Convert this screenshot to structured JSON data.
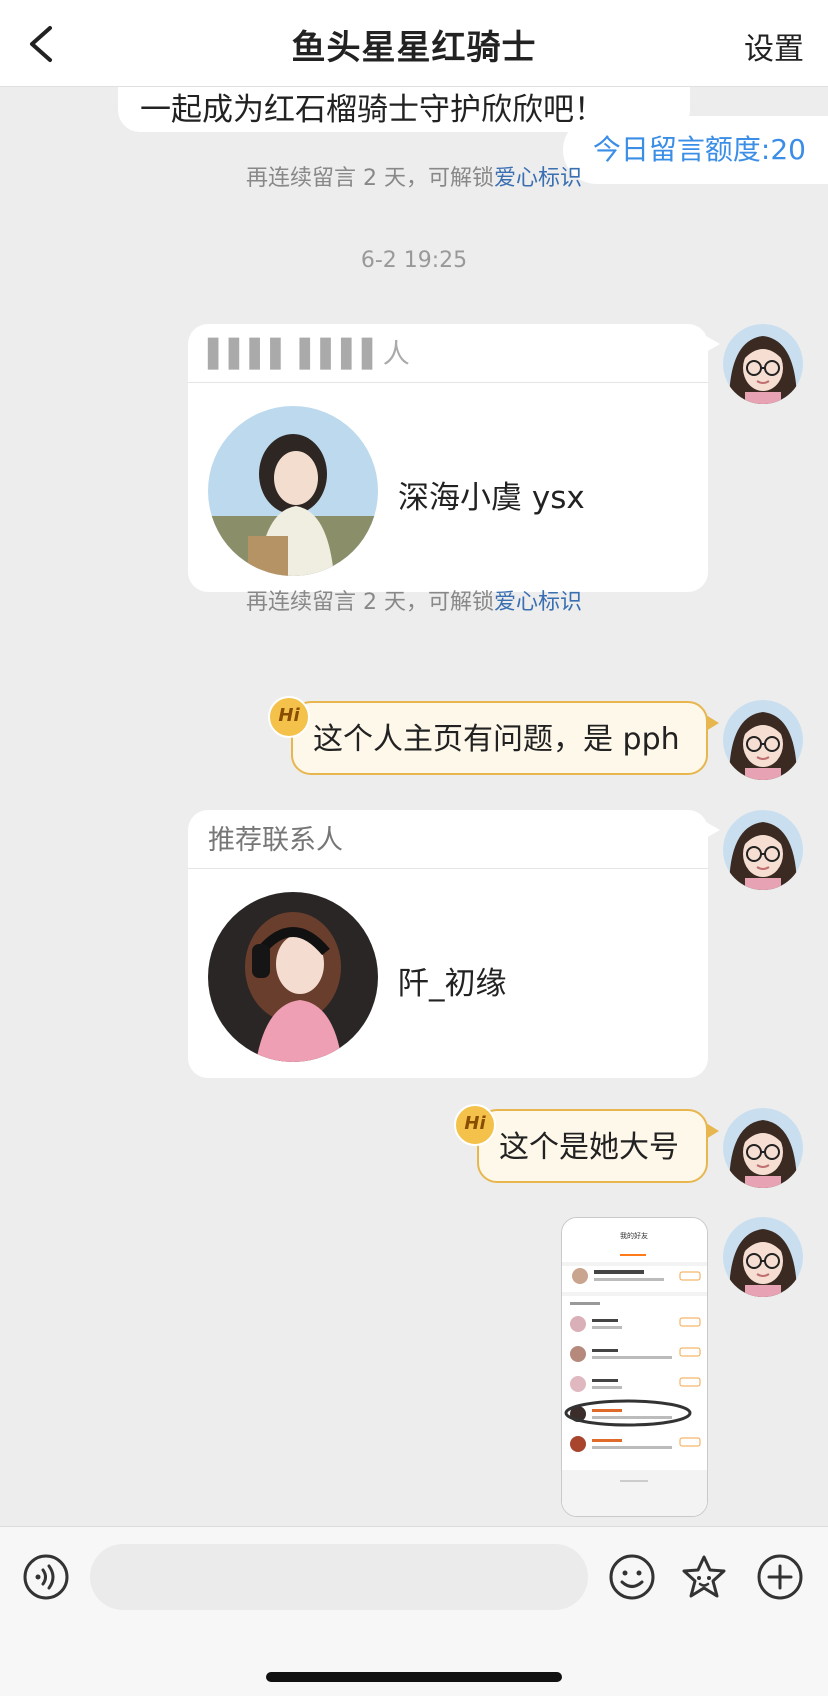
{
  "header": {
    "title": "鱼头星星红骑士",
    "settings_label": "设置"
  },
  "prev_message": {
    "text": "一起成为红石榴骑士守护欣欣吧！"
  },
  "quota": {
    "text": "今日留言额度:20"
  },
  "system_notice": {
    "prefix": "再连续留言 2 天，可解锁",
    "link": "爱心标识"
  },
  "timestamp": "6-2 19:25",
  "messages": [
    {
      "type": "contact_card",
      "header": "▌▌▌▌ ▌▌▌▌人",
      "name": "深海小虞 ysx"
    },
    {
      "type": "text",
      "badge": "Hi",
      "text": "这个人主页有问题，是 pph"
    },
    {
      "type": "contact_card",
      "header": "推荐联系人",
      "name": "阡_初缘"
    },
    {
      "type": "text",
      "badge": "Hi",
      "text": "这个是她大号"
    },
    {
      "type": "image",
      "caption": "我的好友"
    }
  ],
  "input": {
    "placeholder": ""
  },
  "icons": [
    "back-arrow-icon",
    "voice-icon",
    "emoji-icon",
    "sticker-icon",
    "plus-icon"
  ],
  "colors": {
    "accent_blue": "#3a8ee6",
    "link_blue": "#3a6fb2",
    "bubble_border": "#e7b64f",
    "bubble_fill": "#fdf8ea"
  }
}
